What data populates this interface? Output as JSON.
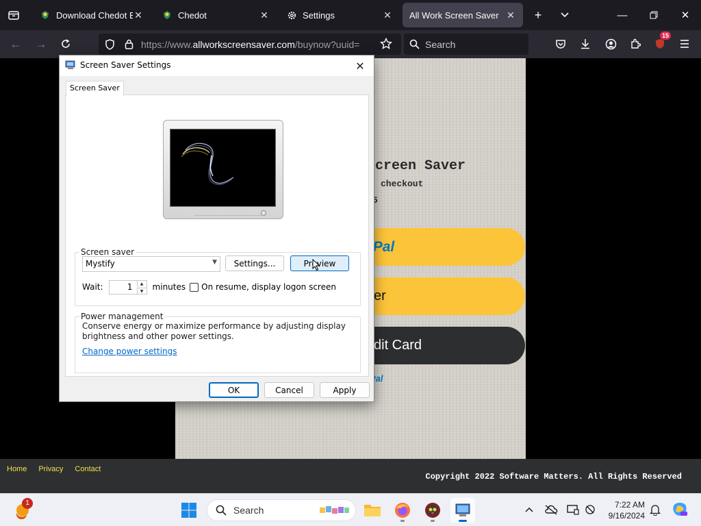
{
  "browser": {
    "tabs": [
      {
        "label": "Download Chedot Bro",
        "icon": "chedot-icon"
      },
      {
        "label": "Chedot",
        "icon": "chedot-icon"
      },
      {
        "label": "Settings",
        "icon": "gear-icon"
      },
      {
        "label": "All Work Screen Saver",
        "icon": "none",
        "active": true
      }
    ],
    "url": {
      "prefix": "https://www.",
      "domain": "allworkscreensaver.com",
      "path": "/buynow?uuid="
    },
    "search_placeholder": "Search",
    "extension_badge": "15"
  },
  "page": {
    "title_fragment": "creen Saver",
    "subtitle_fragment": "checkout",
    "price_fragment": "5",
    "paypal_btn": {
      "p1": "y",
      "p2": "Pal"
    },
    "second_btn_label": "er",
    "card_btn_label": "dit Card",
    "powered_fragment": "Pal",
    "footer_links": [
      "Home",
      "Privacy",
      "Contact"
    ],
    "copyright": "Copyright 2022 Software Matters. All Rights Reserved"
  },
  "dialog": {
    "title": "Screen Saver Settings",
    "tab": "Screen Saver",
    "screensaver_group": "Screen saver",
    "selected_screensaver": "Mystify",
    "settings_button": "Settings...",
    "preview_button": "Preview",
    "wait_label": "Wait:",
    "wait_value": "1",
    "minutes_label": "minutes",
    "resume_label": "On resume, display logon screen",
    "resume_checked": false,
    "power_group": "Power management",
    "power_text": "Conserve energy or maximize performance by adjusting display brightness and other power settings.",
    "power_link": "Change power settings",
    "ok": "OK",
    "cancel": "Cancel",
    "apply": "Apply"
  },
  "taskbar": {
    "search_placeholder": "Search",
    "widget_badge": "1",
    "time": "7:22 AM",
    "date": "9/16/2024"
  },
  "colors": {
    "paypal_yellow": "#fcc439",
    "paypal_blue": "#003087",
    "paypal_light_blue": "#0079c1",
    "footer_link": "#f4e04d",
    "windows_accent": "#0067c0"
  }
}
